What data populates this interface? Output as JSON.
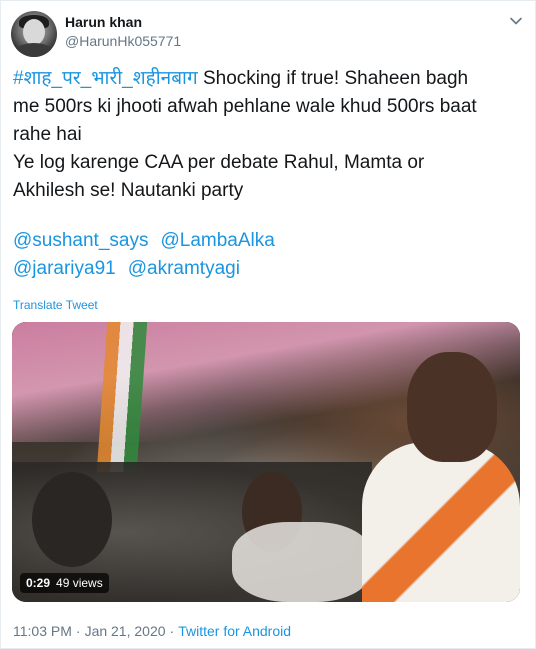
{
  "user": {
    "name": "Harun khan",
    "handle": "@HarunHk055771"
  },
  "tweet": {
    "hashtag": "#शाह_पर_भारी_शहीनबाग",
    "line1_rest": " Shocking if true! Shaheen bagh",
    "line2": "me 500rs ki jhooti afwah pehlane wale khud 500rs baat",
    "line3": "rahe hai",
    "line4": "Ye log karenge CAA per debate Rahul, Mamta or",
    "line5": "Akhilesh se! Nautanki party",
    "mentions": [
      "@sushant_says",
      "@LambaAlka",
      "@jarariya91",
      "@akramtyagi"
    ]
  },
  "translate_label": "Translate Tweet",
  "video": {
    "duration": "0:29",
    "views": "49 views"
  },
  "meta": {
    "time": "11:03 PM",
    "separator": "·",
    "date": "Jan 21, 2020",
    "source": "Twitter for Android"
  },
  "colors": {
    "link": "#1b95e0",
    "secondary_text": "#657786",
    "primary_text": "#14171a"
  },
  "icons": {
    "caret": "chevron-down-icon"
  }
}
